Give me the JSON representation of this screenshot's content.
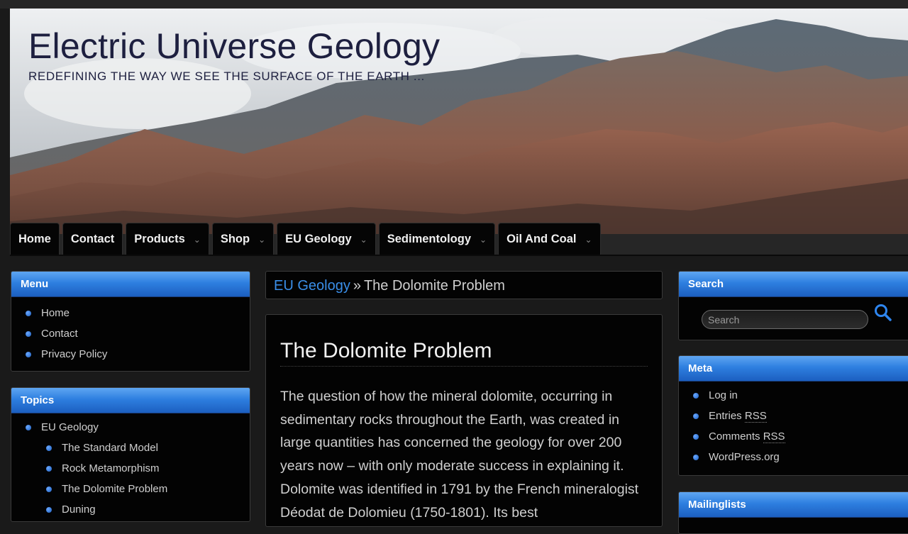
{
  "site": {
    "title": "Electric Universe Geology",
    "tagline": "REDEFINING THE WAY WE SEE THE SURFACE OF THE EARTH ..."
  },
  "nav": {
    "items": [
      {
        "label": "Home",
        "has_dropdown": false
      },
      {
        "label": "Contact",
        "has_dropdown": false
      },
      {
        "label": "Products",
        "has_dropdown": true
      },
      {
        "label": "Shop",
        "has_dropdown": true
      },
      {
        "label": "EU Geology",
        "has_dropdown": true
      },
      {
        "label": "Sedimentology",
        "has_dropdown": true
      },
      {
        "label": "Oil And Coal",
        "has_dropdown": true
      }
    ],
    "dropdown_icon": "chevron-down-icon"
  },
  "menu_widget": {
    "title": "Menu",
    "items": [
      "Home",
      "Contact",
      "Privacy Policy"
    ]
  },
  "topics_widget": {
    "title": "Topics",
    "parent": "EU Geology",
    "children": [
      "The Standard Model",
      "Rock Metamorphism",
      "The Dolomite Problem",
      "Duning"
    ]
  },
  "breadcrumb": {
    "parent": "EU Geology",
    "separator": "»",
    "current": "The Dolomite Problem"
  },
  "article": {
    "title": "The Dolomite Problem",
    "body": "The question of how the mineral dolomite, occurring in sedimentary rocks throughout the Earth, was created in large quantities has concerned the geology for over 200 years now – with only moderate success in explaining it. Dolomite was identified in 1791 by the French mineralogist Déodat de Dolomieu (1750-1801). Its best"
  },
  "search_widget": {
    "title": "Search",
    "placeholder": "Search",
    "icon": "search-icon"
  },
  "meta_widget": {
    "title": "Meta",
    "login": "Log in",
    "entries_pre": "Entries ",
    "entries_abbr": "RSS",
    "comments_pre": "Comments ",
    "comments_abbr": "RSS",
    "wordpress": "WordPress.org"
  },
  "mailinglists_widget": {
    "title": "Mailinglists"
  },
  "colors": {
    "accent_blue": "#2e7fe0",
    "link_blue": "#3a8ee8",
    "title_navy": "#1d1f3f",
    "background": "#1a1a1a"
  }
}
